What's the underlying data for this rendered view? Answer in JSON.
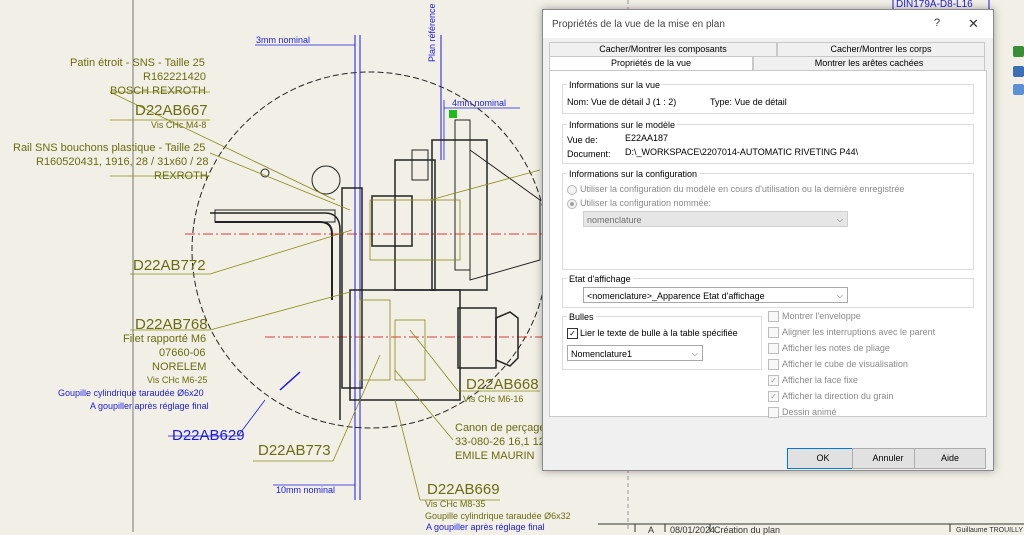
{
  "drawing": {
    "top_right_ref": "DIN179A-D8-L16",
    "dim_3mm": "3mm nominal",
    "dim_4mm": "4mm nominal",
    "dim_10mm": "10mm nominal",
    "plan_ref": "Plan référence",
    "labels": {
      "patin_1": "Patin étroit - SNS - Taille 25",
      "patin_2": "R162221420",
      "patin_3": "BOSCH REXROTH",
      "d22ab667": "D22AB667",
      "d22ab667_sub": "Vis CHc M4-8",
      "rail_1": "Rail SNS bouchons plastique - Taille 25",
      "rail_2": "R160520431, 1916, 28 / 31x60 / 28",
      "rail_3": "REXROTH",
      "d22ab772": "D22AB772",
      "d22ab768": "D22AB768",
      "filet_1": "Filet rapporté M6",
      "filet_2": "07660-06",
      "filet_3": "NORELEM",
      "filet_4": "Vis CHc M6-25",
      "goupille_1": "Goupille cylindrique taraudée Ø6x20",
      "goupille_2": "A goupiller après réglage final",
      "d22ab629": "D22AB629",
      "d22ab773": "D22AB773",
      "d22ab668": "D22AB668",
      "d22ab668_sub": "Vis CHc M6-16",
      "canon_1": "Canon de perçage",
      "canon_2": "33-080-26 16,1 12",
      "canon_3": "EMILE MAURIN",
      "d22ab669": "D22AB669",
      "d22ab669_sub1": "Vis CHc M8-35",
      "d22ab669_sub2": "Goupille cylindrique taraudée Ø6x32",
      "d22ab669_sub3": "A goupiller après réglage final"
    },
    "title_block": {
      "rev": "A",
      "date": "08/01/2024",
      "desc": "Création du plan",
      "author": "Guillaume TROUILLY"
    }
  },
  "dialog": {
    "title": "Propriétés de la vue de la mise en plan",
    "help": "?",
    "close": "✕",
    "tabs": {
      "components": "Cacher/Montrer les composants",
      "bodies": "Cacher/Montrer les corps",
      "view_props": "Propriétés de la vue",
      "hidden_edges": "Montrer les arêtes cachées"
    },
    "view_info": {
      "title": "Informations sur la vue",
      "name": "Nom: Vue de détail J (1 : 2)",
      "type": "Type: Vue de détail"
    },
    "model_info": {
      "title": "Informations sur le modèle",
      "view_label": "Vue de:",
      "view_value": "E22AA187",
      "doc_label": "Document:",
      "doc_value": "D:\\_WORKSPACE\\2207014-AUTOMATIC RIVETING P44\\"
    },
    "config_info": {
      "title": "Informations sur la configuration",
      "opt1": "Utiliser la configuration du modèle en cours d'utilisation ou la dernière enregistrée",
      "opt2": "Utiliser la configuration nommée:",
      "named_value": "nomenclature"
    },
    "display_state": {
      "title": "Etat d'affichage",
      "value": "<nomenclature>_Apparence Etat d'affichage"
    },
    "balloons": {
      "title": "Bulles",
      "link_label": "Lier le texte de bulle à la table spécifiée",
      "table_value": "Nomenclature1"
    },
    "options": [
      {
        "label": "Montrer l'enveloppe",
        "checked": false
      },
      {
        "label": "Aligner les interruptions avec le parent",
        "checked": false
      },
      {
        "label": "Afficher les notes de pliage",
        "checked": false
      },
      {
        "label": "Afficher le cube de visualisation",
        "checked": false
      },
      {
        "label": "Afficher la face fixe",
        "checked": true
      },
      {
        "label": "Afficher la direction du grain",
        "checked": true
      },
      {
        "label": "Dessin animé",
        "checked": false
      }
    ],
    "buttons": {
      "ok": "OK",
      "cancel": "Annuler",
      "help": "Aide"
    }
  },
  "colors": {
    "olive": "#6b6b10",
    "blue": "#1a1ae0",
    "red": "#d40000",
    "dialog_bg": "#f0f0f0"
  }
}
